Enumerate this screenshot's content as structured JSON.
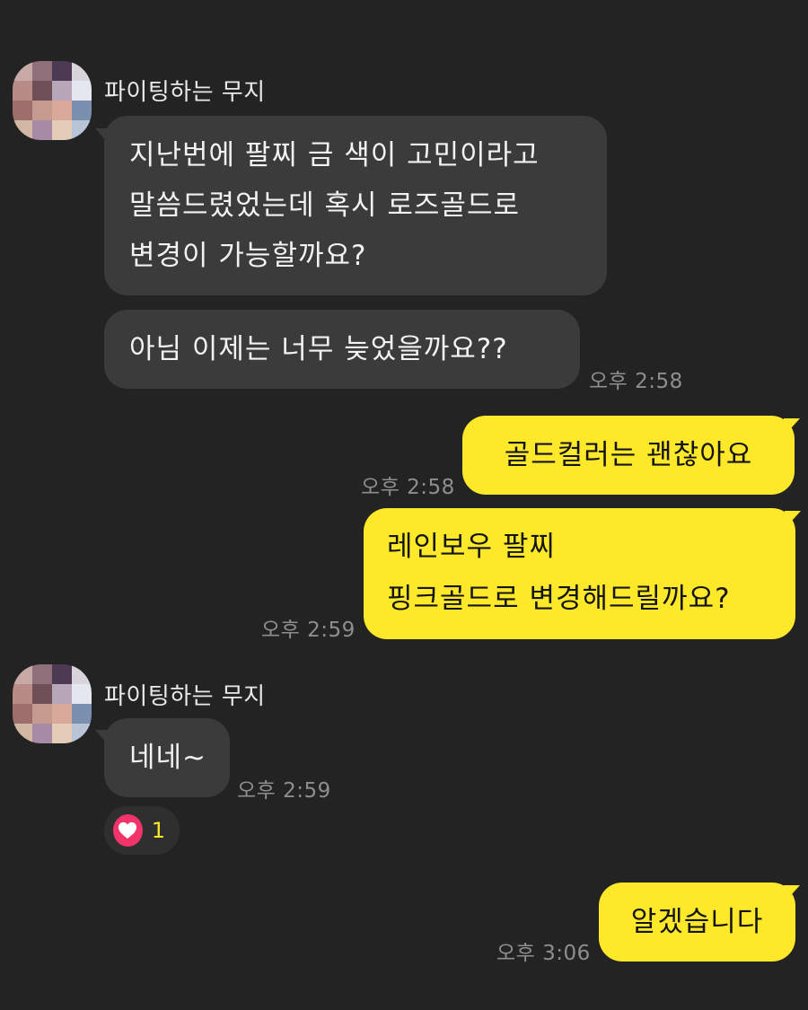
{
  "chat": {
    "group1": {
      "sender": "파이팅하는 무지",
      "messages": [
        "지난번에 팔찌 금 색이 고민이라고\n말씀드렸었는데 혹시 로즈골드로\n변경이 가능할까요?",
        "아님 이제는 너무 늦었을까요??"
      ],
      "time": "오후 2:58"
    },
    "out1": {
      "text": "골드컬러는 괜찮아요",
      "time": "오후 2:58"
    },
    "out2": {
      "text": "레인보우 팔찌\n핑크골드로 변경해드릴까요?",
      "time": "오후 2:59"
    },
    "group2": {
      "sender": "파이팅하는 무지",
      "message": "네네~",
      "time": "오후 2:59",
      "reaction": {
        "icon": "heart-icon",
        "count": "1"
      }
    },
    "out3": {
      "text": "알겠습니다",
      "time": "오후 3:06"
    }
  },
  "colors": {
    "background": "#232324",
    "incoming_bubble": "#3b3b3c",
    "outgoing_bubble": "#fde92a",
    "heart": "#f2346b",
    "reaction_count": "#fde92a"
  }
}
